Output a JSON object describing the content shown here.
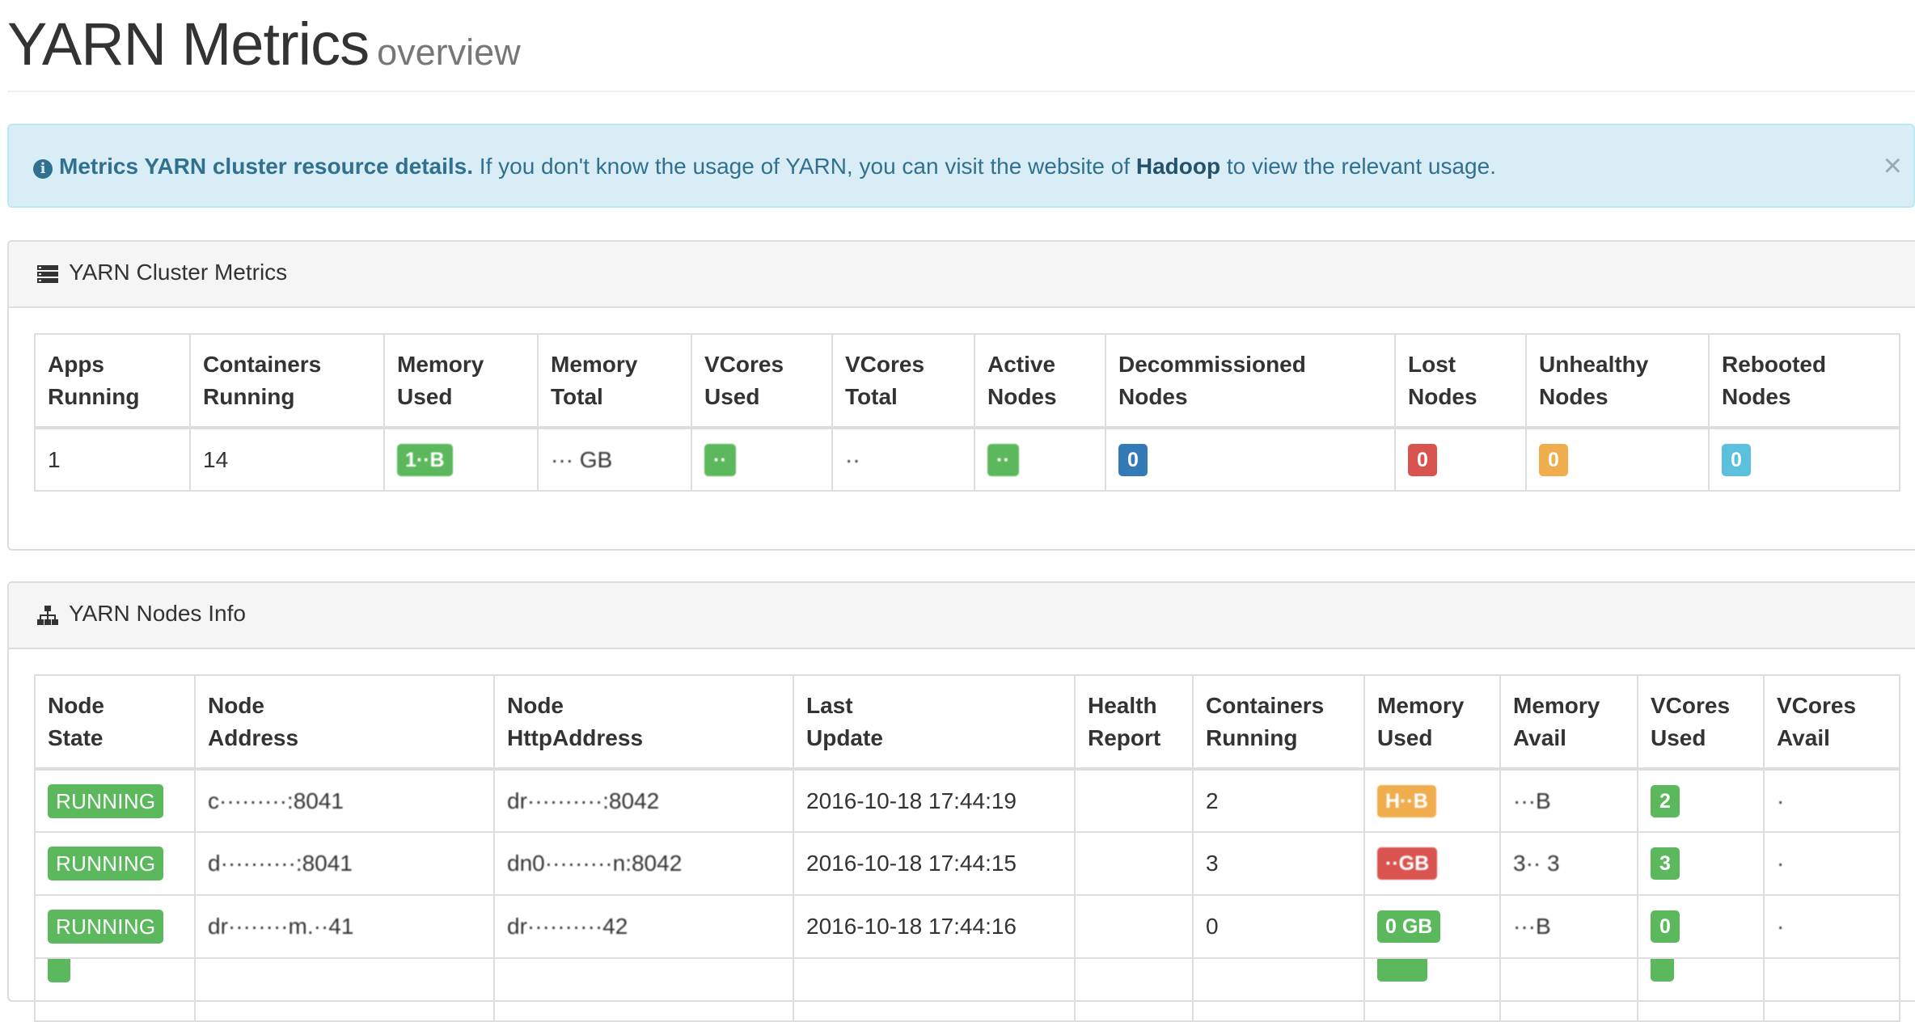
{
  "header": {
    "title": "YARN Metrics",
    "subtitle": "overview"
  },
  "alert": {
    "icon": "info-circle-icon",
    "strong": "Metrics YARN cluster resource details.",
    "text1": " If you don't know the usage of YARN, you can visit the website of ",
    "link": "Hadoop",
    "text2": " to view the relevant usage.",
    "close": "×"
  },
  "cluster": {
    "title": "YARN Cluster Metrics",
    "icon": "server-icon",
    "columns": [
      [
        "Apps",
        "Running"
      ],
      [
        "Containers",
        "Running"
      ],
      [
        "Memory",
        "Used"
      ],
      [
        "Memory",
        "Total"
      ],
      [
        "VCores",
        "Used"
      ],
      [
        "VCores",
        "Total"
      ],
      [
        "Active",
        "Nodes"
      ],
      [
        "Decommissioned",
        "Nodes"
      ],
      [
        "Lost",
        "Nodes"
      ],
      [
        "Unhealthy",
        "Nodes"
      ],
      [
        "Rebooted",
        "Nodes"
      ]
    ],
    "values": {
      "apps_running": "1",
      "containers_running": "14",
      "memory_used": "1··B",
      "memory_total": "··· GB",
      "vcores_used": "··",
      "vcores_total": "··",
      "active_nodes": "··",
      "decommissioned_nodes": "0",
      "lost_nodes": "0",
      "unhealthy_nodes": "0",
      "rebooted_nodes": "0"
    }
  },
  "nodes": {
    "title": "YARN Nodes Info",
    "icon": "sitemap-icon",
    "columns": [
      [
        "Node",
        "State"
      ],
      [
        "Node",
        "Address"
      ],
      [
        "Node",
        "HttpAddress"
      ],
      [
        "Last",
        "Update"
      ],
      [
        "Health",
        "Report"
      ],
      [
        "Containers",
        "Running"
      ],
      [
        "Memory",
        "Used"
      ],
      [
        "Memory",
        "Avail"
      ],
      [
        "VCores",
        "Used"
      ],
      [
        "VCores",
        "Avail"
      ]
    ],
    "rows": [
      {
        "state": "RUNNING",
        "address": "c·········:8041",
        "http": "dr··········:8042",
        "updated": "2016-10-18 17:44:19",
        "health": "",
        "containers": "2",
        "mem_used": "H··B",
        "mem_avail": "···B",
        "vcores_used": "2",
        "vcores_avail": "·"
      },
      {
        "state": "RUNNING",
        "address": "d··········:8041",
        "http": "dn0·········n:8042",
        "updated": "2016-10-18 17:44:15",
        "health": "",
        "containers": "3",
        "mem_used": "··GB",
        "mem_avail": "3·· 3",
        "vcores_used": "3",
        "vcores_avail": "·"
      },
      {
        "state": "RUNNING",
        "address": "dr········m.··41",
        "http": "dr··········42",
        "updated": "2016-10-18 17:44:16",
        "health": "",
        "containers": "0",
        "mem_used": "0 GB",
        "mem_avail": "···B",
        "vcores_used": "0",
        "vcores_avail": "·"
      }
    ]
  },
  "colors": {
    "success": "#5cb85c",
    "primary": "#337ab7",
    "danger": "#d9534f",
    "warning": "#f0ad4e",
    "info": "#5bc0de",
    "alert_bg": "#d9edf7",
    "alert_text": "#31708f"
  }
}
